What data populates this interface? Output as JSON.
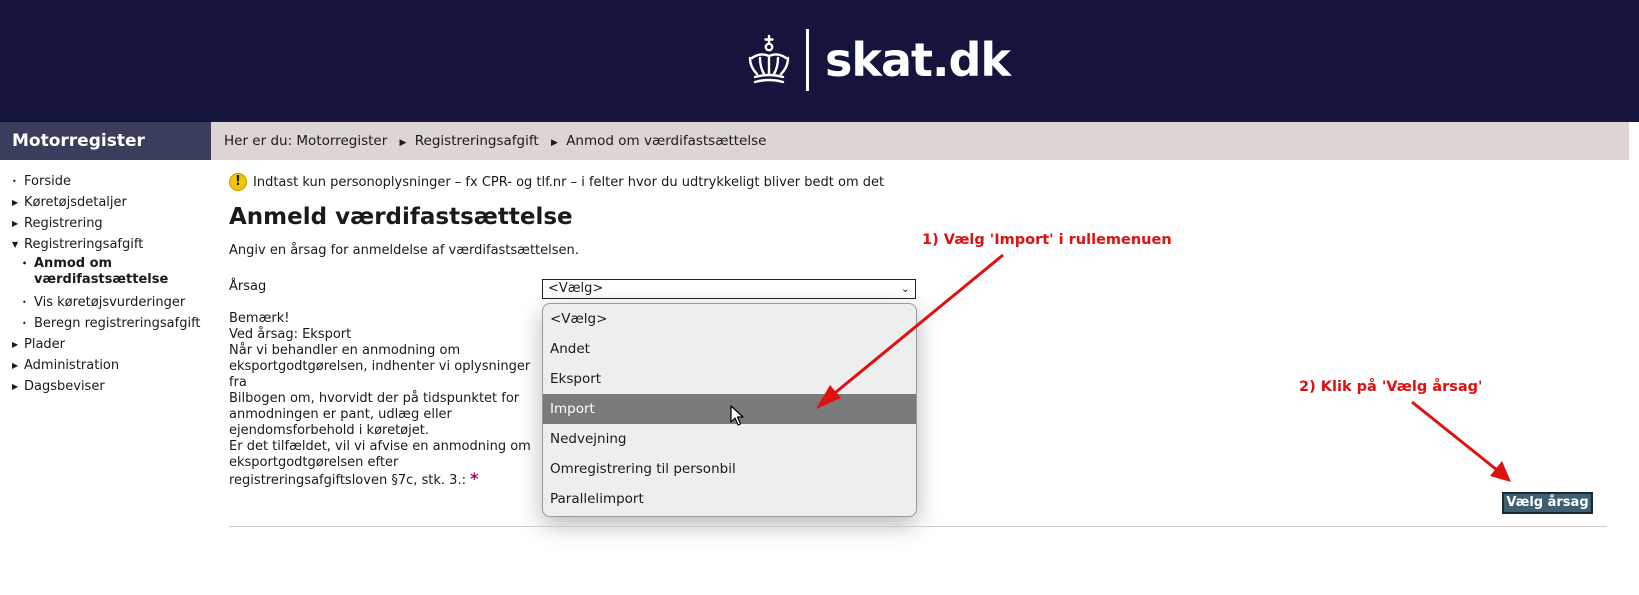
{
  "header": {
    "brand": "skat.dk"
  },
  "sidebar": {
    "title": "Motorregister",
    "items": [
      {
        "label": "Forside",
        "marker": "•",
        "level": 0
      },
      {
        "label": "Køretøjsdetaljer",
        "marker": "▶",
        "level": 0
      },
      {
        "label": "Registrering",
        "marker": "▶",
        "level": 0
      },
      {
        "label": "Registreringsafgift",
        "marker": "▼",
        "level": 0
      },
      {
        "label": "Anmod om værdifastsættelse",
        "marker": "•",
        "level": 1,
        "active": true
      },
      {
        "label": "Vis køretøjsvurderinger",
        "marker": "•",
        "level": 1
      },
      {
        "label": "Beregn registreringsafgift",
        "marker": "•",
        "level": 1
      },
      {
        "label": "Plader",
        "marker": "▶",
        "level": 0
      },
      {
        "label": "Administration",
        "marker": "▶",
        "level": 0
      },
      {
        "label": "Dagsbeviser",
        "marker": "▶",
        "level": 0
      }
    ]
  },
  "breadcrumb": {
    "prefix": "Her er du: Motorregister",
    "items": [
      "Registreringsafgift",
      "Anmod om værdifastsættelse"
    ]
  },
  "notice": "Indtast kun personoplysninger – fx CPR- og tlf.nr – i felter hvor du udtrykkeligt bliver bedt om det",
  "page": {
    "title": "Anmeld værdifastsættelse",
    "intro": "Angiv en årsag for anmeldelse af værdifastsættelsen.",
    "field_label": "Årsag",
    "select_value": "<Vælg>",
    "note_lines": [
      "Bemærk!",
      "Ved årsag: Eksport",
      "Når vi behandler en anmodning om",
      "eksportgodtgørelsen, indhenter vi oplysninger fra",
      "Bilbogen om, hvorvidt der på tidspunktet for",
      "anmodningen er pant, udlæg eller",
      "ejendomsforbehold i køretøjet.",
      "Er det tilfældet, vil vi afvise en anmodning om",
      "eksportgodtgørelsen efter",
      "registreringsafgiftsloven §7c, stk. 3.:"
    ],
    "required_mark": "*",
    "submit_label": "Vælg årsag"
  },
  "dropdown": {
    "options": [
      "<Vælg>",
      "Andet",
      "Eksport",
      "Import",
      "Nedvejning",
      "Omregistrering til personbil",
      "Parallelimport"
    ],
    "highlighted": 3
  },
  "annotations": {
    "step1": "1) Vælg 'Import' i rullemenuen",
    "step2": "2) Klik på 'Vælg årsag'",
    "color": "#e01010"
  },
  "colors": {
    "header_bg": "#14143c",
    "sidebar_title_bg": "#3a3d5c",
    "breadcrumb_bg": "#ddd5d3",
    "button_bg": "#3f5f73"
  }
}
